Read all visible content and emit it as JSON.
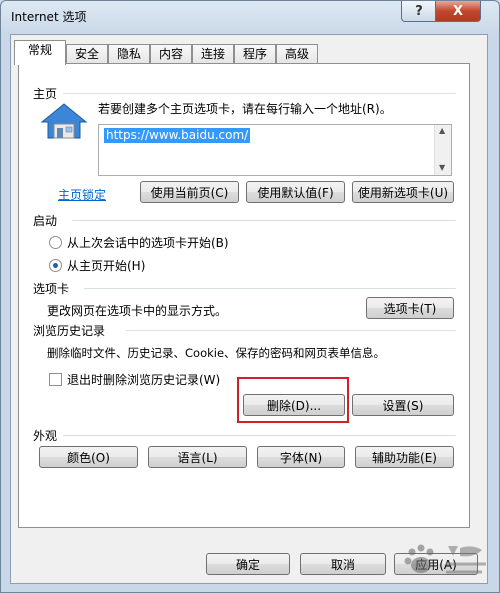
{
  "window": {
    "title": "Internet 选项",
    "help_label": "?",
    "close_label": "X"
  },
  "tabs": [
    {
      "label": "常规",
      "active": true
    },
    {
      "label": "安全"
    },
    {
      "label": "隐私"
    },
    {
      "label": "内容"
    },
    {
      "label": "连接"
    },
    {
      "label": "程序"
    },
    {
      "label": "高级"
    }
  ],
  "homepage": {
    "group_label": "主页",
    "instruction": "若要创建多个主页选项卡，请在每行输入一个地址(R)。",
    "url": "https://www.baidu.com/",
    "lock_link": "主页锁定",
    "use_current": "使用当前页(C)",
    "use_default": "使用默认值(F)",
    "use_new_tab": "使用新选项卡(U)"
  },
  "startup": {
    "group_label": "启动",
    "option1": "从上次会话中的选项卡开始(B)",
    "option2": "从主页开始(H)",
    "selected": "option2"
  },
  "tabs_section": {
    "group_label": "选项卡",
    "description": "更改网页在选项卡中的显示方式。",
    "button": "选项卡(T)"
  },
  "history": {
    "group_label": "浏览历史记录",
    "description": "删除临时文件、历史记录、Cookie、保存的密码和网页表单信息。",
    "checkbox_label": "退出时删除浏览历史记录(W)",
    "checked": false,
    "delete_button": "删除(D)...",
    "settings_button": "设置(S)"
  },
  "appearance": {
    "group_label": "外观",
    "colors": "颜色(O)",
    "languages": "语言(L)",
    "fonts": "字体(N)",
    "accessibility": "辅助功能(E)"
  },
  "footer": {
    "ok": "确定",
    "cancel": "取消",
    "apply": "应用(A)"
  },
  "colors": {
    "highlight_box": "#d0202a",
    "selection": "#3399ff",
    "link": "#0066cc"
  }
}
